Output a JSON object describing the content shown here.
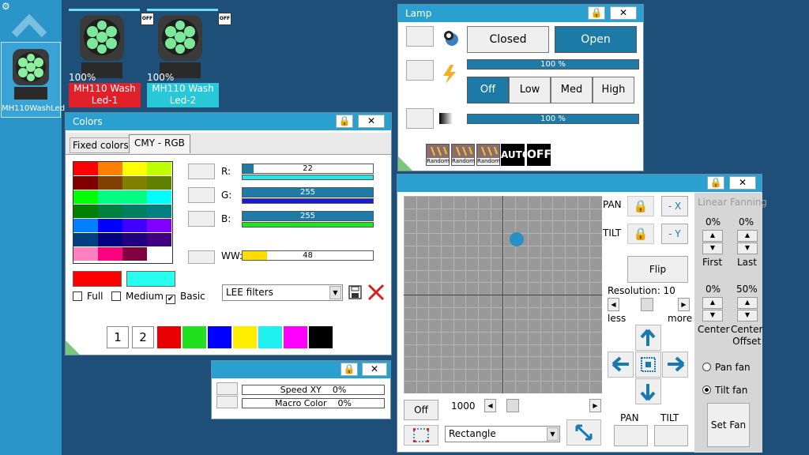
{
  "sidebar": {
    "fixture_label": "MH110WashLed"
  },
  "fixtures": [
    {
      "percent": "100%",
      "name_line1": "MH110 Wash",
      "name_line2": "Led-1",
      "color": "#e0212a",
      "off_label": "OFF"
    },
    {
      "percent": "100%",
      "name_line1": "MH110 Wash",
      "name_line2": "Led-2",
      "color": "#29c8d8",
      "off_label": "OFF"
    }
  ],
  "colors_panel": {
    "title": "Colors",
    "tabs": [
      "Fixed colors",
      "CMY - RGB"
    ],
    "channels": [
      {
        "label": "R:",
        "value": "22",
        "fraction": 0.086,
        "strip_color": "#28e3e3"
      },
      {
        "label": "G:",
        "value": "255",
        "fraction": 1.0,
        "strip_color": "#1a1ad0"
      },
      {
        "label": "B:",
        "value": "255",
        "fraction": 1.0,
        "strip_color": "#1de81d"
      }
    ],
    "ww": {
      "label": "WW:",
      "value": "48",
      "fraction": 0.19
    },
    "palette": [
      [
        "#ff0000",
        "#ff8000",
        "#ffff00",
        "#c0ff00"
      ],
      [
        "#800000",
        "#804000",
        "#808000",
        "#608000"
      ],
      [
        "#00ff00",
        "#00ff80",
        "#00ff80",
        "#00ffff"
      ],
      [
        "#008000",
        "#008040",
        "#008060",
        "#008080"
      ],
      [
        "#0080ff",
        "#0000ff",
        "#4000ff",
        "#8000ff"
      ],
      [
        "#004080",
        "#000080",
        "#200080",
        "#400080"
      ],
      [
        "#ff80c0",
        "#ff0080",
        "#800040",
        "#ffffff"
      ]
    ],
    "current_color": "#ff0000",
    "target_color": "#28fff0",
    "checkboxes": [
      {
        "label": "Full",
        "checked": false
      },
      {
        "label": "Medium",
        "checked": false
      },
      {
        "label": "Basic",
        "checked": true
      }
    ],
    "filter_select": "LEE filters",
    "presets": [
      "1",
      "2"
    ],
    "preset_colors": [
      "#e80000",
      "#20e020",
      "#0000ff",
      "#ffee00",
      "#20f0f0",
      "#ff00ff",
      "#000000"
    ]
  },
  "lamp_panel": {
    "title": "Lamp",
    "closed_label": "Closed",
    "open_label": "Open",
    "intensity_text": "100 %",
    "modes": [
      "Off",
      "Low",
      "Med",
      "High"
    ],
    "dimmer_text": "100 %",
    "effects": [
      "Random",
      "Random",
      "Random"
    ],
    "auto_label": "AUTO",
    "off_label": "OFF"
  },
  "speed_panel": {
    "rows": [
      {
        "label": "Speed XY",
        "value": "0%"
      },
      {
        "label": "Macro Color",
        "value": "0%"
      }
    ]
  },
  "position_panel": {
    "pan_label": "PAN",
    "tilt_label": "TILT",
    "invert_x": "- X",
    "invert_y": "- Y",
    "flip_label": "Flip",
    "resolution_label": "Resolution: 10",
    "less_label": "less",
    "more_label": "more",
    "off_label": "Off",
    "speed_value": "1000",
    "shape_select": "Rectangle",
    "pan_bottom": "PAN",
    "tilt_bottom": "TILT",
    "fanning_title": "Linear Fanning",
    "first_pct": "0%",
    "last_pct": "0%",
    "first_label": "First",
    "last_label": "Last",
    "center_pct": "0%",
    "offset_pct": "50%",
    "center_label": "Center",
    "offset_label_1": "Center",
    "offset_label_2": "Offset",
    "pan_fan": "Pan fan",
    "tilt_fan": "Tilt fan",
    "set_fan": "Set Fan",
    "dot_pan": 0.57,
    "dot_tilt": 0.22
  }
}
